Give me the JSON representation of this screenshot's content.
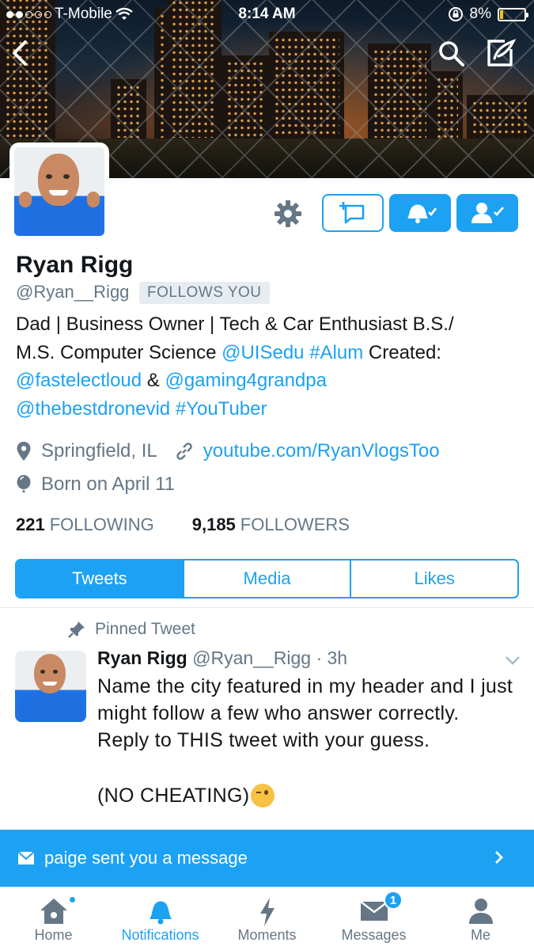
{
  "status_bar": {
    "carrier": "T-Mobile",
    "time": "8:14 AM",
    "battery": "8%",
    "battery_level": 0.08
  },
  "profile": {
    "name": "Ryan Rigg",
    "handle": "@Ryan__Rigg",
    "follows_you": "FOLLOWS YOU",
    "bio": {
      "line1": "Dad | Business Owner | Tech & Car Enthusiast B.S./",
      "line2_a": "M.S. Computer Science ",
      "line2_mention": "@UISedu",
      "line2_tag": "#Alum",
      "line2_b": " Created:",
      "line3_mention1": "@fastelectloud",
      "line3_amp": " & ",
      "line3_mention2": "@gaming4grandpa",
      "line4_mention": "@thebestdronevid",
      "line4_tag": "#YouTuber"
    },
    "location": "Springfield, IL",
    "website": "youtube.com/RyanVlogsToo",
    "birthday": "Born on April 11",
    "following_count": "221",
    "following_label": "FOLLOWING",
    "followers_count": "9,185",
    "followers_label": "FOLLOWERS"
  },
  "tabs": [
    "Tweets",
    "Media",
    "Likes"
  ],
  "pinned_tweet": {
    "pinned_label": "Pinned Tweet",
    "author_name": "Ryan Rigg",
    "author_handle": "@Ryan__Rigg",
    "separator": "·",
    "time": "3h",
    "text": "Name the city featured in my header and I just might follow a few who answer correctly. Reply to THIS tweet with your guess.",
    "text2": "(NO CHEATING)"
  },
  "message_banner": {
    "text": "paige sent you a message"
  },
  "tab_bar": {
    "home": "Home",
    "notifications": "Notifications",
    "moments": "Moments",
    "messages": "Messages",
    "messages_badge": "1",
    "me": "Me"
  },
  "colors": {
    "accent": "#1da1f2",
    "secondary_text": "#657786",
    "primary_text": "#14171a"
  }
}
